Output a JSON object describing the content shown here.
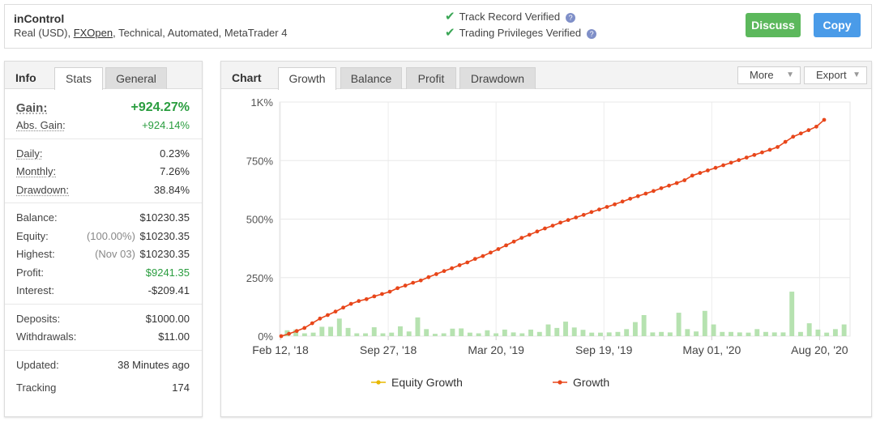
{
  "header": {
    "name": "inControl",
    "desc_prefix": "Real (USD), ",
    "broker": "FXOpen",
    "desc_suffix": ", Technical, Automated, MetaTrader 4",
    "verified_track": "Track Record Verified",
    "verified_privileges": "Trading Privileges Verified",
    "help_glyph": "?",
    "discuss_label": "Discuss",
    "copy_label": "Copy"
  },
  "info": {
    "title": "Info",
    "tabs": [
      "Stats",
      "General"
    ],
    "gain_label": "Gain:",
    "gain_value": "+924.27%",
    "abs_gain_label": "Abs. Gain:",
    "abs_gain_value": "+924.14%",
    "daily_label": "Daily:",
    "daily_value": "0.23%",
    "monthly_label": "Monthly:",
    "monthly_value": "7.26%",
    "drawdown_label": "Drawdown:",
    "drawdown_value": "38.84%",
    "balance_label": "Balance:",
    "balance_value": "$10230.35",
    "equity_label": "Equity:",
    "equity_sub": "(100.00%)",
    "equity_value": "$10230.35",
    "highest_label": "Highest:",
    "highest_sub": "(Nov 03)",
    "highest_value": "$10230.35",
    "profit_label": "Profit:",
    "profit_value": "$9241.35",
    "interest_label": "Interest:",
    "interest_value": "-$209.41",
    "deposits_label": "Deposits:",
    "deposits_value": "$1000.00",
    "withdrawals_label": "Withdrawals:",
    "withdrawals_value": "$11.00",
    "updated_label": "Updated:",
    "updated_value": "38 Minutes ago",
    "tracking_label": "Tracking",
    "tracking_value": "174"
  },
  "chart_panel": {
    "title": "Chart",
    "tabs": [
      "Growth",
      "Balance",
      "Profit",
      "Drawdown"
    ],
    "more_label": "More",
    "export_label": "Export"
  },
  "colors": {
    "growth_line": "#e8461a",
    "equity_line": "#e8b800",
    "bars": "#b6e2b0",
    "accent_green": "#2a9d3f"
  },
  "chart_data": {
    "type": "line",
    "ylim": [
      0,
      1000
    ],
    "yticks": [
      "0%",
      "250%",
      "500%",
      "750%",
      "1K%"
    ],
    "xticks": [
      "Feb 12, '18",
      "Sep 27, '18",
      "Mar 20, '19",
      "Sep 19, '19",
      "May 01, '20",
      "Aug 20, '20"
    ],
    "legend": [
      "Equity Growth",
      "Growth"
    ],
    "series": [
      {
        "name": "Growth",
        "values": [
          0,
          10,
          22,
          35,
          55,
          75,
          90,
          105,
          122,
          138,
          150,
          158,
          170,
          180,
          190,
          205,
          216,
          228,
          238,
          252,
          265,
          278,
          290,
          303,
          315,
          330,
          342,
          357,
          372,
          388,
          404,
          420,
          433,
          447,
          460,
          472,
          485,
          496,
          507,
          518,
          530,
          541,
          552,
          563,
          575,
          587,
          598,
          609,
          620,
          632,
          643,
          654,
          666,
          686,
          697,
          708,
          719,
          730,
          741,
          752,
          763,
          774,
          785,
          796,
          808,
          830,
          852,
          866,
          880,
          895,
          924
        ]
      },
      {
        "name": "Equity Growth",
        "values": [
          0,
          10,
          22,
          35,
          55,
          75,
          90,
          105,
          122,
          138,
          150,
          158,
          170,
          180,
          190,
          205,
          216,
          228,
          238,
          252,
          265,
          278,
          290,
          303,
          315,
          330,
          342,
          357,
          372,
          388,
          404,
          420,
          433,
          447,
          460,
          472,
          485,
          496,
          507,
          518,
          530,
          541,
          552,
          563,
          575,
          587,
          598,
          609,
          620,
          632,
          643,
          654,
          666,
          686,
          697,
          708,
          719,
          730,
          741,
          752,
          763,
          774,
          785,
          796,
          808,
          830,
          852,
          866,
          880,
          895,
          924
        ]
      },
      {
        "name": "Monthly",
        "type": "bar",
        "values": [
          25,
          28,
          12,
          15,
          40,
          40,
          75,
          35,
          12,
          12,
          38,
          12,
          15,
          42,
          20,
          80,
          30,
          10,
          12,
          32,
          33,
          15,
          12,
          25,
          12,
          28,
          16,
          12,
          28,
          18,
          50,
          35,
          62,
          37,
          27,
          15,
          15,
          16,
          18,
          30,
          60,
          90,
          16,
          18,
          16,
          100,
          30,
          20,
          108,
          50,
          18,
          18,
          16,
          15,
          30,
          18,
          16,
          16,
          190,
          18,
          55,
          28,
          15,
          30,
          50
        ]
      }
    ]
  }
}
